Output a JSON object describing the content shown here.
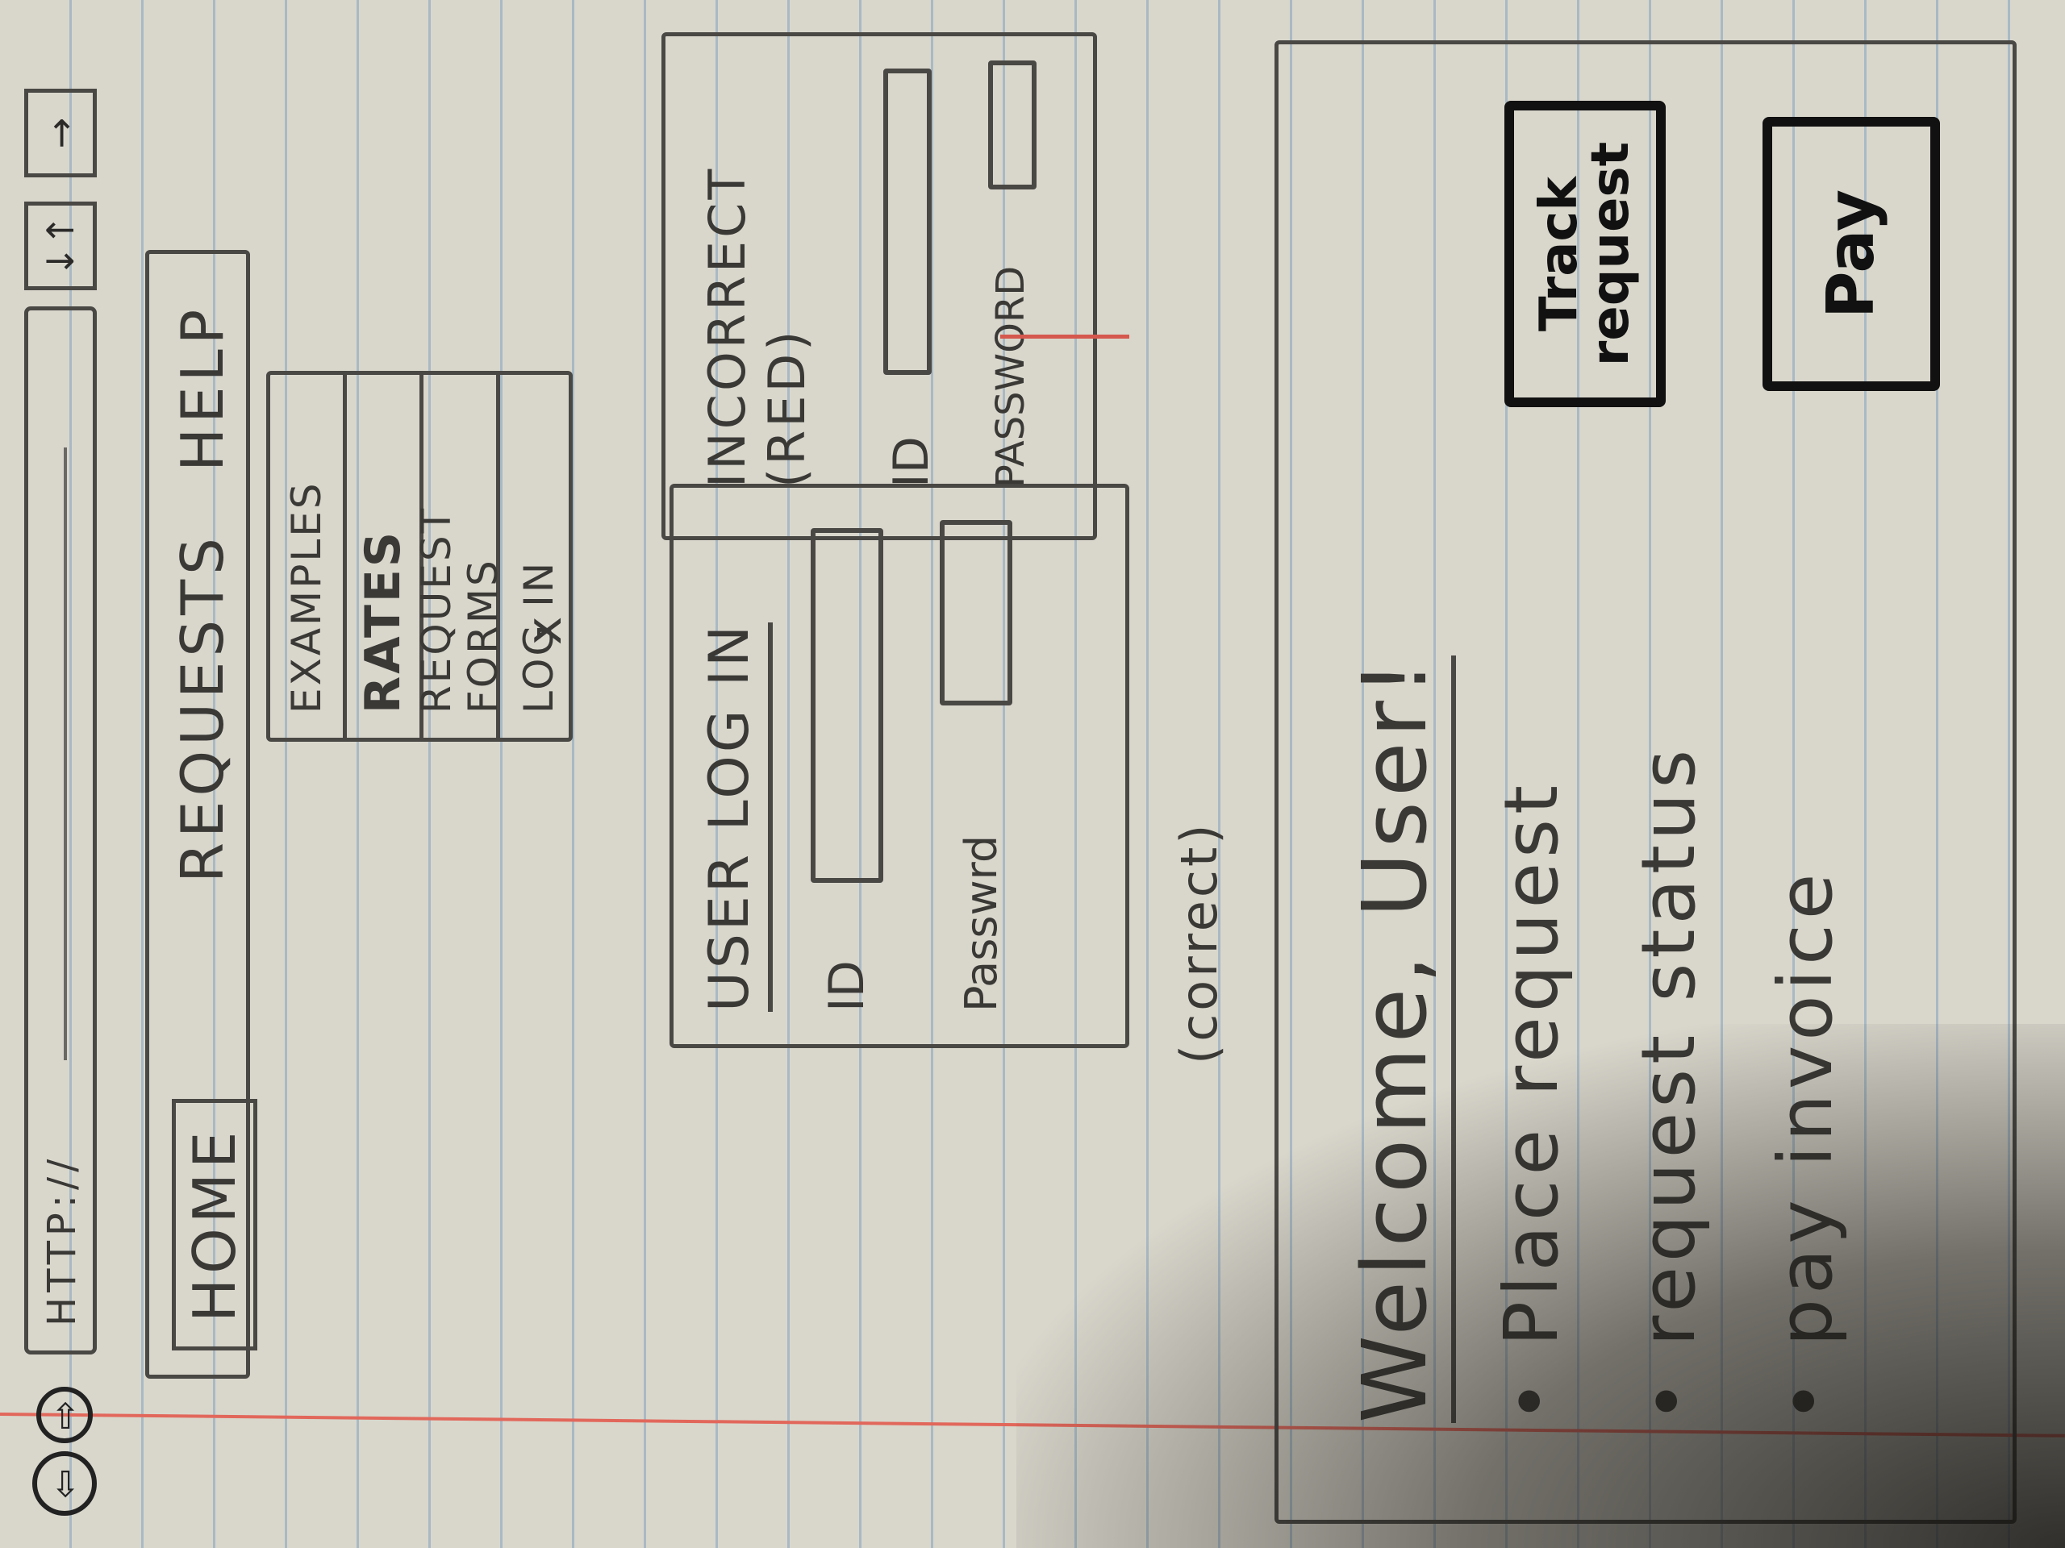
{
  "browser": {
    "back_icon": "back-arrow-icon",
    "forward_icon": "forward-arrow-icon",
    "url_text": "HTTP://",
    "reload_glyph": "↓↑",
    "go_glyph": "→"
  },
  "nav": {
    "home": "HOME",
    "requests": "REQUESTS",
    "help": "HELP"
  },
  "dropdown": {
    "items": [
      "EXAMPLES",
      "RATES",
      "REQUEST FORMS",
      "LOG IN"
    ]
  },
  "marks": {
    "x": "x"
  },
  "login": {
    "title": "USER LOG IN",
    "id_label": "ID",
    "password_label": "Passwrd"
  },
  "login_error": {
    "title_line1": "INCORRECT",
    "title_line2": "(RED)",
    "id_label": "ID",
    "password_label": "PASSWORD"
  },
  "correct_note": "(correct)",
  "welcome": {
    "title": "Welcome, User!",
    "bullets": [
      "Place request",
      "request status",
      "pay invoice"
    ],
    "track_button": "Track request",
    "pay_button": "Pay"
  },
  "colors": {
    "paper": "#d9d7cc",
    "rule_line": "#a9b9c4",
    "margin_line": "#e2675b",
    "pencil": "#4a4844",
    "ink": "#111111",
    "red_accent": "#d5584e"
  }
}
